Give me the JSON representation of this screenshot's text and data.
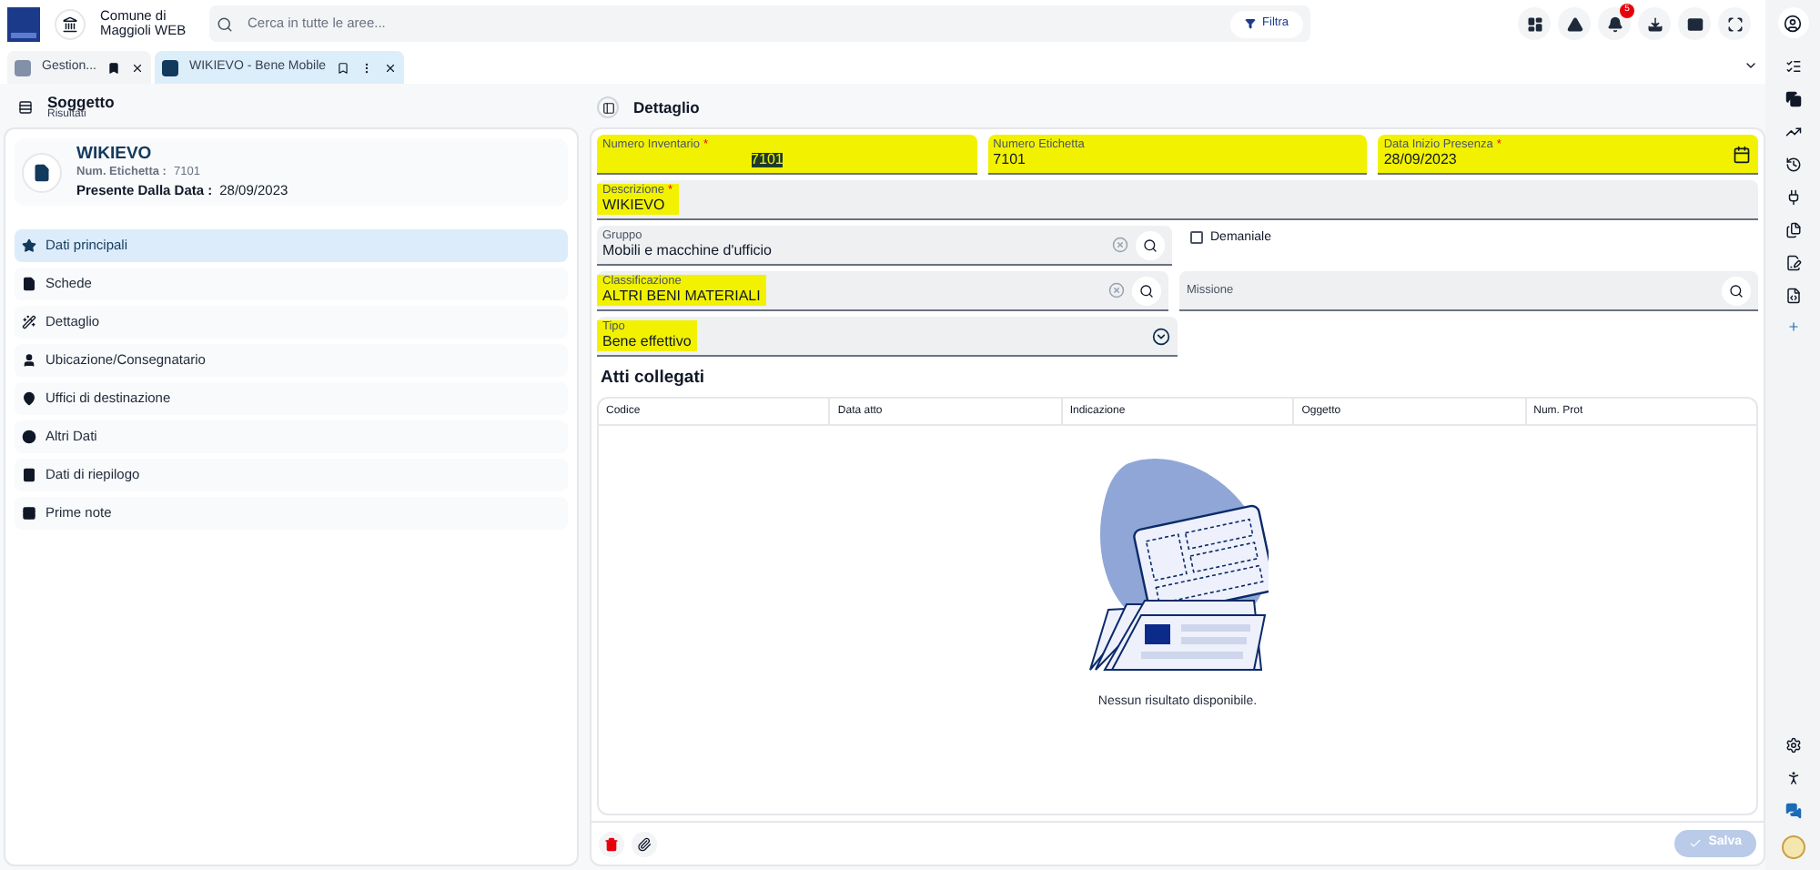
{
  "app": {
    "title": "Comune di Maggioli WEB",
    "search_placeholder": "Cerca in tutte le aree...",
    "filter_label": "Filtra",
    "notification_badge": "5"
  },
  "tabs": [
    {
      "label": "Gestion...",
      "selected": false
    },
    {
      "label": "WIKIEVO - Bene Mobile",
      "selected": true
    }
  ],
  "left_panel": {
    "title": "Soggetto",
    "subtitle": "Risultati",
    "record": {
      "name": "WIKIEVO",
      "label_key": "Num. Etichetta :",
      "label_value": "7101",
      "date_key": "Presente Dalla Data :",
      "date_value": "28/09/2023"
    },
    "menu": [
      {
        "label": "Dati principali",
        "selected": true
      },
      {
        "label": "Schede",
        "selected": false
      },
      {
        "label": "Dettaglio",
        "selected": false
      },
      {
        "label": "Ubicazione/Consegnatario",
        "selected": false
      },
      {
        "label": "Uffici di destinazione",
        "selected": false
      },
      {
        "label": "Altri Dati",
        "selected": false
      },
      {
        "label": "Dati di riepilogo",
        "selected": false
      },
      {
        "label": "Prime note",
        "selected": false
      }
    ]
  },
  "detail": {
    "title": "Dettaglio",
    "rows": [
      [
        {
          "kind": "text",
          "label": "Numero Inventario",
          "value": "7101",
          "required_mark": "*",
          "highlighted": true,
          "value_selected": true
        },
        {
          "kind": "text",
          "label": "Numero Etichetta",
          "value": "7101",
          "highlighted": true
        },
        {
          "kind": "date",
          "label": "Data Inizio Presenza",
          "value": "28/09/2023",
          "required_mark": "*",
          "highlighted": true
        }
      ],
      [
        {
          "kind": "text",
          "label": "Descrizione",
          "value": "WIKIEVO",
          "required_mark": "*",
          "highlighted": true
        }
      ],
      [
        {
          "kind": "lookup",
          "label": "Gruppo",
          "value": "Mobili e macchine d'ufficio",
          "highlighted": false
        },
        {
          "kind": "checkbox",
          "label": "Demaniale",
          "checked": false
        }
      ],
      [
        {
          "kind": "lookup",
          "label": "Classificazione",
          "value": "ALTRI BENI MATERIALI",
          "highlighted": true
        },
        {
          "kind": "search",
          "placeholder": "Missione"
        }
      ],
      [
        {
          "kind": "select",
          "label": "Tipo",
          "value": "Bene effettivo",
          "highlighted": true
        }
      ]
    ],
    "section_title": "Atti collegati",
    "table": {
      "columns": [
        "Codice",
        "Data atto",
        "Indicazione",
        "Oggetto",
        "Num. Prot"
      ],
      "empty_message": "Nessun risultato disponibile."
    },
    "save_label": "Salva",
    "save_disabled": true
  }
}
